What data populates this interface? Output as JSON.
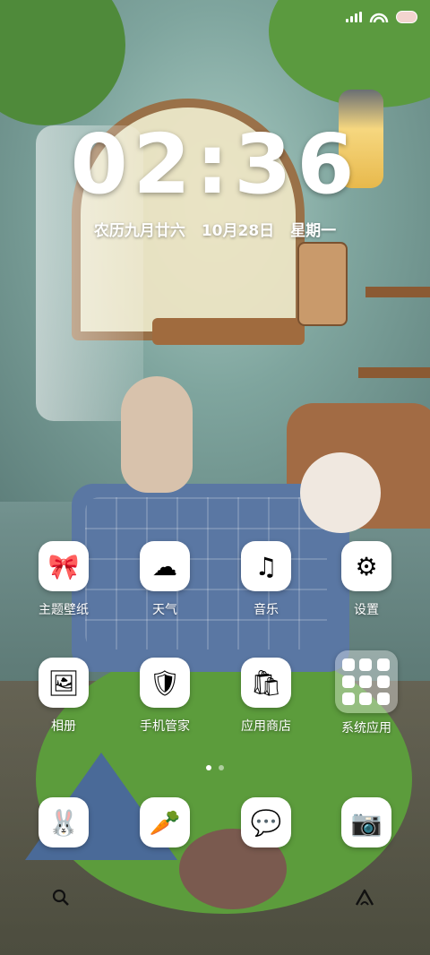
{
  "status_bar": {
    "icons": [
      "signal-icon",
      "wifi-rainbow-icon",
      "battery-pill-icon"
    ]
  },
  "clock": {
    "time": "02:36",
    "date_lunar": "农历九月廿六",
    "date_solar": "10月28日",
    "weekday": "星期一"
  },
  "apps": [
    {
      "label": "主题壁纸",
      "icon": "theme-wallpaper-icon",
      "glyph": "🎀"
    },
    {
      "label": "天气",
      "icon": "weather-icon",
      "glyph": "☁"
    },
    {
      "label": "音乐",
      "icon": "music-icon",
      "glyph": "♫"
    },
    {
      "label": "设置",
      "icon": "settings-icon",
      "glyph": "⚙"
    },
    {
      "label": "相册",
      "icon": "gallery-icon",
      "glyph": "🖼"
    },
    {
      "label": "手机管家",
      "icon": "phone-manager-icon",
      "glyph": "🛡"
    },
    {
      "label": "应用商店",
      "icon": "app-store-icon",
      "glyph": "🛍"
    },
    {
      "label": "系统应用",
      "icon": "system-apps-folder-icon",
      "glyph": ""
    }
  ],
  "dock": [
    {
      "icon": "bunny-app-icon",
      "glyph": "🐰"
    },
    {
      "icon": "carrot-app-icon",
      "glyph": "🥕"
    },
    {
      "icon": "messages-app-icon",
      "glyph": "💬"
    },
    {
      "icon": "camera-app-icon",
      "glyph": "📷"
    }
  ],
  "page_indicator": {
    "pages": 2,
    "current": 1
  },
  "colors": {
    "text": "#ffffff",
    "accent_pink": "#f3d4cf"
  }
}
